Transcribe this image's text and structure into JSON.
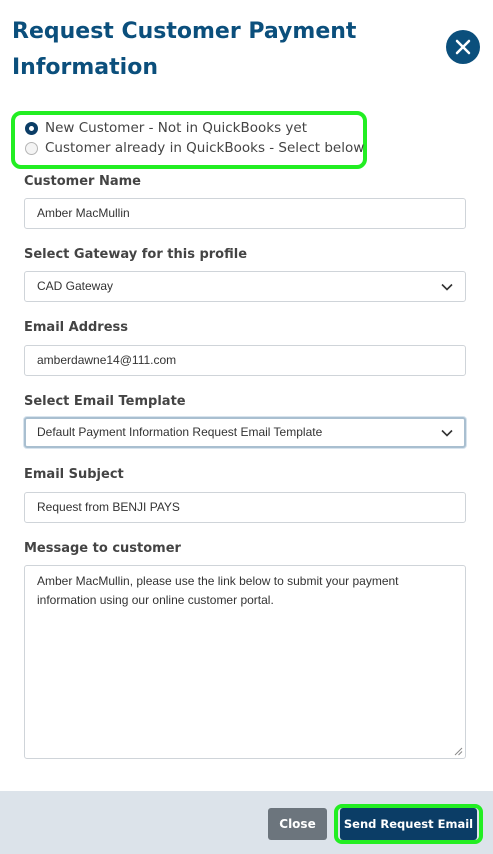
{
  "dialog": {
    "title": "Request Customer Payment Information",
    "close_icon": "close-icon"
  },
  "customer_type": {
    "options": [
      {
        "label": "New Customer - Not in QuickBooks yet",
        "checked": true
      },
      {
        "label": "Customer already in QuickBooks - Select below",
        "checked": false
      }
    ]
  },
  "form": {
    "customer_name": {
      "label": "Customer Name",
      "value": "Amber MacMullin"
    },
    "gateway": {
      "label": "Select Gateway for this profile",
      "value": "CAD Gateway"
    },
    "email": {
      "label": "Email Address",
      "value": "amberdawne14@111.com"
    },
    "template": {
      "label": "Select Email Template",
      "value": "Default Payment Information Request Email Template"
    },
    "subject": {
      "label": "Email Subject",
      "value": "Request from BENJI PAYS"
    },
    "message": {
      "label": "Message to customer",
      "value": "Amber MacMullin, please use the link below to submit your payment information using our online customer portal."
    }
  },
  "footer": {
    "close_label": "Close",
    "send_label": "Send Request Email"
  },
  "colors": {
    "brand": "#0b4f7c",
    "primary_button": "#0b3d66",
    "secondary_button": "#6c757d",
    "highlight": "#22ee22",
    "footer_bg": "#dce3ea"
  }
}
